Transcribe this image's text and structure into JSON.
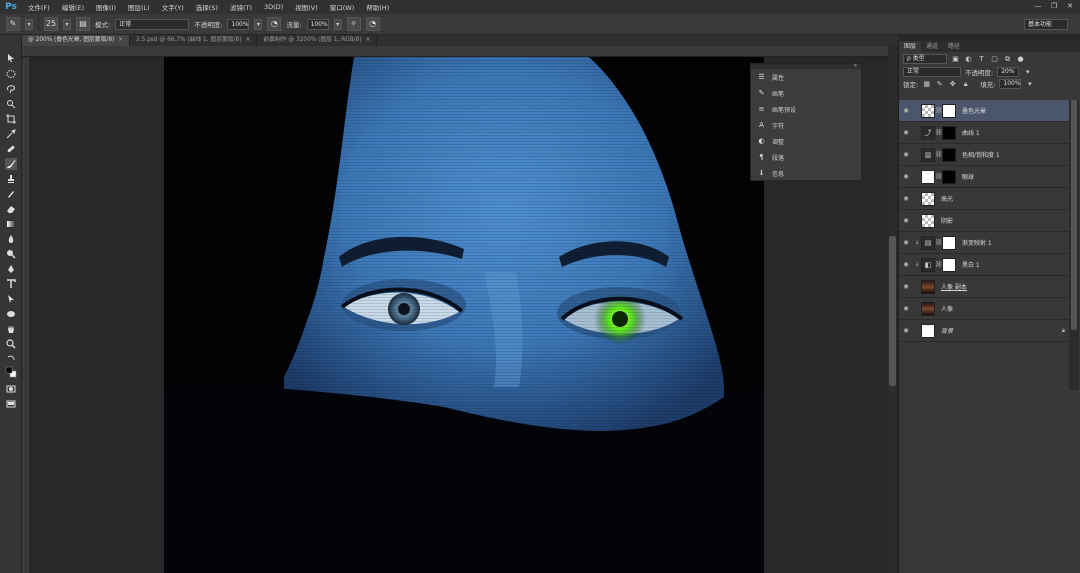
{
  "app": {
    "logo": "Ps"
  },
  "menu": [
    "文件(F)",
    "编辑(E)",
    "图像(I)",
    "图层(L)",
    "文字(Y)",
    "选择(S)",
    "滤镜(T)",
    "3D(D)",
    "视图(V)",
    "窗口(W)",
    "帮助(H)"
  ],
  "window_controls": {
    "minimize": "—",
    "restore": "❐",
    "close": "✕"
  },
  "options_bar": {
    "brush_size": "25",
    "mode_label": "模式:",
    "mode_value": "正常",
    "opacity_label": "不透明度:",
    "opacity_value": "100%",
    "flow_label": "流量:",
    "flow_value": "100%",
    "workspace": "基本功能"
  },
  "doc_tabs": [
    {
      "label": "@ 200% (叠色光晕, 图层蒙版/8)",
      "close": "×"
    },
    {
      "label": "2.5.psd @ 66.7% (曲线 1, 图层蒙版/8)",
      "close": "×"
    },
    {
      "label": "前景制作 @ 3200% (图层 1, RGB/8)",
      "close": "×"
    }
  ],
  "float_panel": {
    "close": "»",
    "items": [
      {
        "icon": "properties-icon",
        "glyph": "☰",
        "label": "属性"
      },
      {
        "icon": "brush-icon",
        "glyph": "✎",
        "label": "画笔"
      },
      {
        "icon": "brush-presets-icon",
        "glyph": "≡",
        "label": "画笔预设"
      },
      {
        "icon": "character-icon",
        "glyph": "A",
        "label": "字符"
      },
      {
        "icon": "adjustments-icon",
        "glyph": "◐",
        "label": "调整"
      },
      {
        "icon": "paragraph-icon",
        "glyph": "¶",
        "label": "段落"
      },
      {
        "icon": "info-icon",
        "glyph": "ℹ",
        "label": "信息"
      }
    ]
  },
  "layers_panel": {
    "tabs": [
      "图层",
      "通道",
      "路径"
    ],
    "filter_label": "ρ 类型",
    "blend_mode": "正常",
    "opacity_label": "不透明度:",
    "opacity_value": "20%",
    "lock_label": "锁定:",
    "fill_label": "填充:",
    "fill_value": "100%",
    "layers": [
      {
        "name": "叠色光晕",
        "selected": true
      },
      {
        "name": "曲线 1"
      },
      {
        "name": "色相/饱和度 1"
      },
      {
        "name": "眼球"
      },
      {
        "name": "高光"
      },
      {
        "name": "阴影"
      },
      {
        "name": "渐变映射 1"
      },
      {
        "name": "黑白 1"
      },
      {
        "name": "人像 副本"
      },
      {
        "name": "人像"
      },
      {
        "name": "背景",
        "locked": true
      }
    ]
  }
}
